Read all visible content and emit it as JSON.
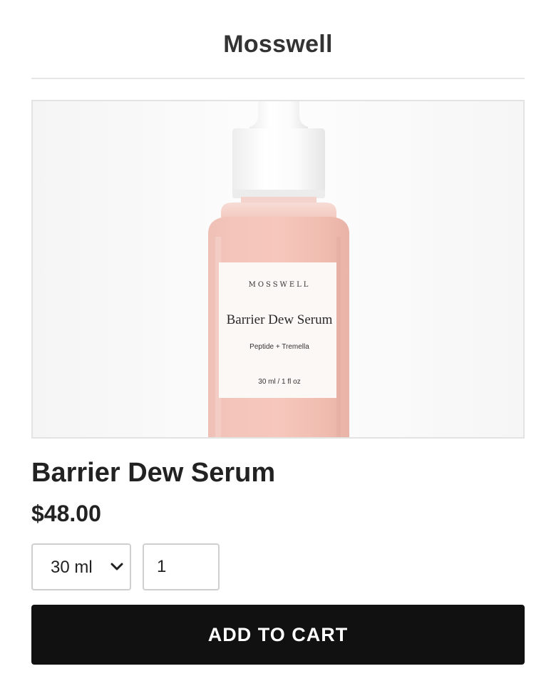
{
  "header": {
    "brand": "Mosswell"
  },
  "product_image": {
    "label_brand": "MOSSWELL",
    "label_name": "Barrier Dew Serum",
    "label_ingredients": "Peptide + Tremella",
    "label_size": "30 ml / 1 fl oz"
  },
  "product": {
    "title": "Barrier Dew Serum",
    "price": "$48.00"
  },
  "variant_select": {
    "selected": "30 ml",
    "icon": "chevron-down-icon"
  },
  "quantity": {
    "value": "1"
  },
  "add_to_cart": {
    "label": "ADD TO CART"
  },
  "colors": {
    "button_bg": "#111111",
    "button_text": "#ffffff",
    "serum_pink": "#f2b9ad",
    "border": "#cfcfcf"
  }
}
